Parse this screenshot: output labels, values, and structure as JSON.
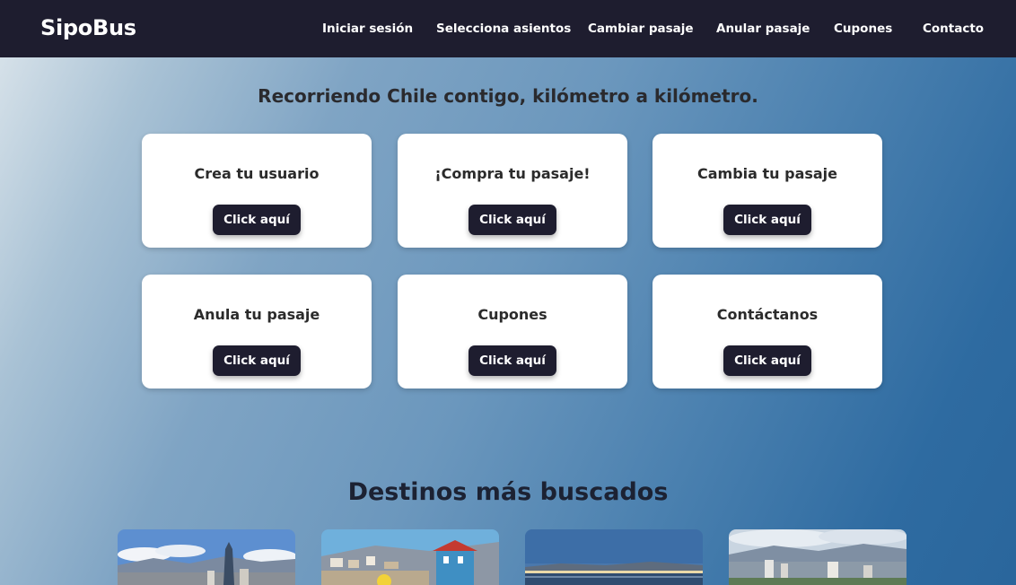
{
  "header": {
    "brand": "SipoBus",
    "nav": [
      {
        "label": "Iniciar sesión"
      },
      {
        "label": "Selecciona asientos"
      },
      {
        "label": "Cambiar pasaje"
      },
      {
        "label": "Anular pasaje"
      },
      {
        "label": "Cupones"
      },
      {
        "label": "Contacto"
      }
    ]
  },
  "hero": {
    "tagline": "Recorriendo Chile contigo, kilómetro a kilómetro."
  },
  "cards": [
    {
      "title": "Crea tu usuario",
      "button": "Click aquí"
    },
    {
      "title": "¡Compra tu pasaje!",
      "button": "Click aquí"
    },
    {
      "title": "Cambia tu pasaje",
      "button": "Click aquí"
    },
    {
      "title": "Anula tu pasaje",
      "button": "Click aquí"
    },
    {
      "title": "Cupones",
      "button": "Click aquí"
    },
    {
      "title": "Contáctanos",
      "button": "Click aquí"
    }
  ],
  "destinations": {
    "title": "Destinos más buscados"
  },
  "colors": {
    "navbar": "#1e1d2f",
    "button": "#1e1d2f",
    "card": "#ffffff"
  }
}
